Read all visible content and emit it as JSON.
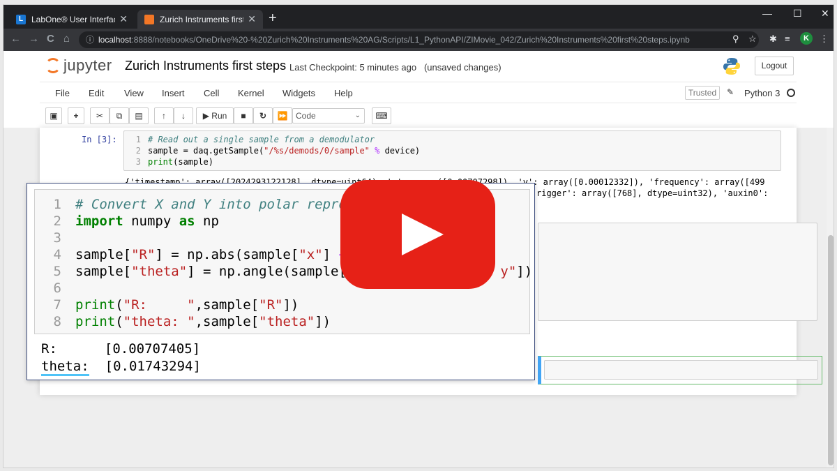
{
  "browser": {
    "tabs": [
      {
        "title": "LabOne® User Interface",
        "favicon_color": "#1976d2",
        "favicon_letter": "L"
      },
      {
        "title": "Zurich Instruments first steps - Ju",
        "favicon_color": "#f37726"
      }
    ],
    "new_tab": "+",
    "window_controls": {
      "minimize": "—",
      "maximize": "☐",
      "close": "✕"
    },
    "nav": {
      "back": "←",
      "forward": "→",
      "reload": "C",
      "home": "⌂"
    },
    "address": {
      "host": "localhost",
      "path": ":8888/notebooks/OneDrive%20-%20Zurich%20Instruments%20AG/Scripts/L1_PythonAPI/ZIMovie_042/Zurich%20Instruments%20first%20steps.ipynb"
    },
    "profile_initial": "K"
  },
  "jupyter": {
    "logo_text": "jupyter",
    "notebook_title": "Zurich Instruments first steps",
    "checkpoint": "Last Checkpoint: 5 minutes ago",
    "save_status": "(unsaved changes)",
    "logout": "Logout",
    "menu": [
      "File",
      "Edit",
      "View",
      "Insert",
      "Cell",
      "Kernel",
      "Widgets",
      "Help"
    ],
    "trusted": "Trusted",
    "kernel": "Python 3",
    "toolbar": {
      "run": "Run",
      "cell_type": "Code"
    }
  },
  "notebook": {
    "cell1": {
      "prompt": "In [3]:",
      "lines": [
        "1",
        "2",
        "3"
      ],
      "comment": "# Read out a single sample from a demodulator",
      "line2_a": "sample = daq.getSample(",
      "line2_str": "\"/%s/demods/0/sample\"",
      "line2_op": " % ",
      "line2_b": "device)",
      "line3_fn": "print",
      "line3_rest": "(sample)"
    },
    "output1_line1": "{'timestamp': array([2024293122128], dtype=uint64), 'x': array([0.00707298]), 'y': array([0.00012332]), 'frequency': array([499",
    "output1_line2": "rigger': array([768], dtype=uint32), 'auxin0':"
  },
  "zoomed": {
    "line_numbers": [
      "1",
      "2",
      "3",
      "4",
      "5",
      "6",
      "7",
      "8"
    ],
    "l1_comment": "# Convert X and Y into polar repres",
    "l2_kw1": "import",
    "l2_mid": " numpy ",
    "l2_kw2": "as",
    "l2_end": " np",
    "l4_a": "sample[",
    "l4_s1": "\"R\"",
    "l4_b": "] = np.abs(sample[",
    "l4_s2": "\"x\"",
    "l4_c": "] ",
    "l4_op": "+",
    "l5_a": "sample[",
    "l5_s1": "\"theta\"",
    "l5_b": "] = np.angle(sample[",
    "l5_s2": "\"",
    "l5_s3": "y\"",
    "l5_c": "])",
    "l7_fn": "print",
    "l7_a": "(",
    "l7_s1": "\"R:     \"",
    "l7_b": ",sample[",
    "l7_s2": "\"R\"",
    "l7_c": "])",
    "l8_fn": "print",
    "l8_a": "(",
    "l8_s1": "\"theta: \"",
    "l8_b": ",sample[",
    "l8_s2": "\"theta\"",
    "l8_c": "])",
    "out_r_label": "R:",
    "out_r_value": "[0.00707405]",
    "out_theta_label": "theta:",
    "out_theta_value": "[0.01743294]"
  },
  "colors": {
    "youtube_red": "#e62117",
    "jupyter_orange": "#f37726",
    "prompt_blue": "#303f9f"
  }
}
